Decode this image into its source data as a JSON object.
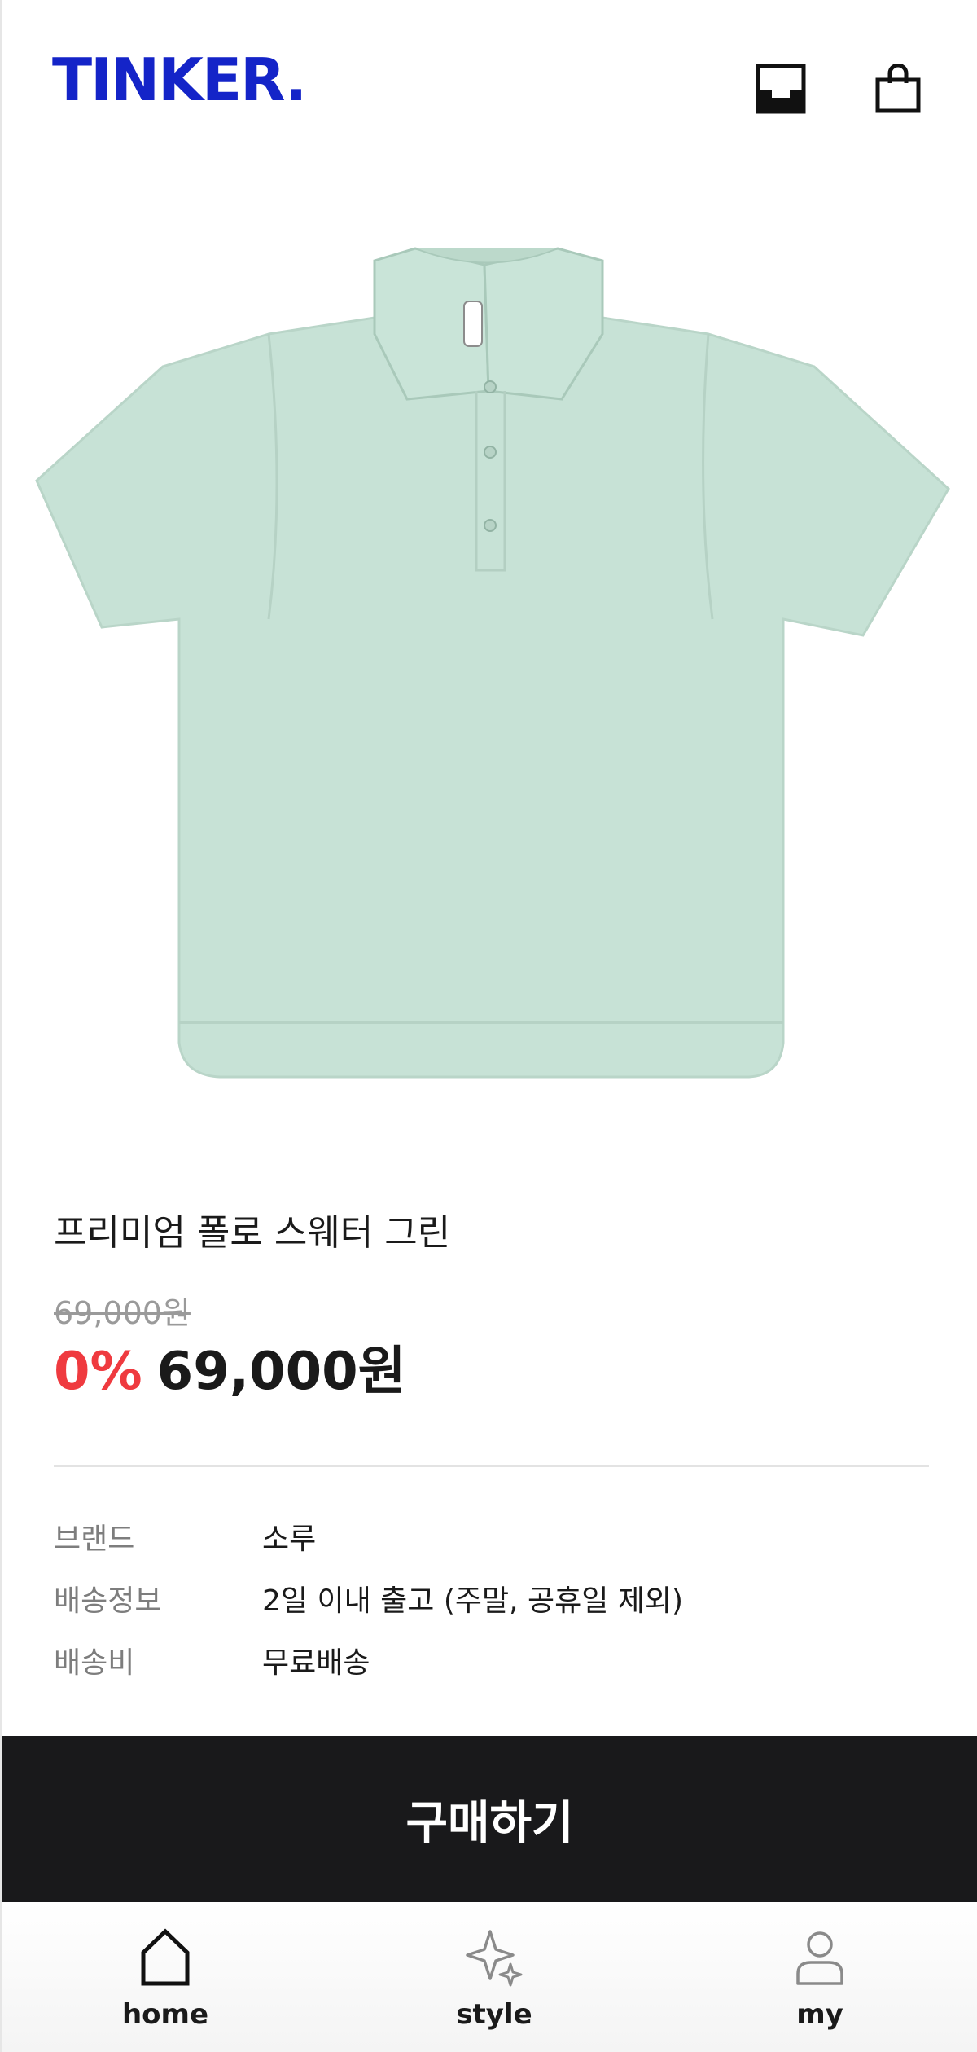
{
  "header": {
    "logo": "TINKER.",
    "icons": [
      "inbox-icon",
      "shopping-bag-icon"
    ]
  },
  "product": {
    "image_icon": "polo-sweater-image",
    "title": "프리미엄 폴로 스웨터 그린",
    "original_price": "69,000원",
    "discount": "0%",
    "sale_price": "69,000원",
    "info": [
      {
        "label": "브랜드",
        "value": "소루"
      },
      {
        "label": "배송정보",
        "value": "2일 이내 출고 (주말, 공휴일 제외)"
      },
      {
        "label": "배송비",
        "value": "무료배송"
      }
    ]
  },
  "buy_button": {
    "label": "구매하기"
  },
  "bottom_nav": {
    "items": [
      {
        "label": "home",
        "icon": "home-icon"
      },
      {
        "label": "style",
        "icon": "sparkle-icon"
      },
      {
        "label": "my",
        "icon": "user-icon"
      }
    ]
  },
  "colors": {
    "logo": "#1424c8",
    "discount": "#ef3a3f",
    "buy_button_bg": "#19191b",
    "shirt": "#c7e2d6"
  }
}
